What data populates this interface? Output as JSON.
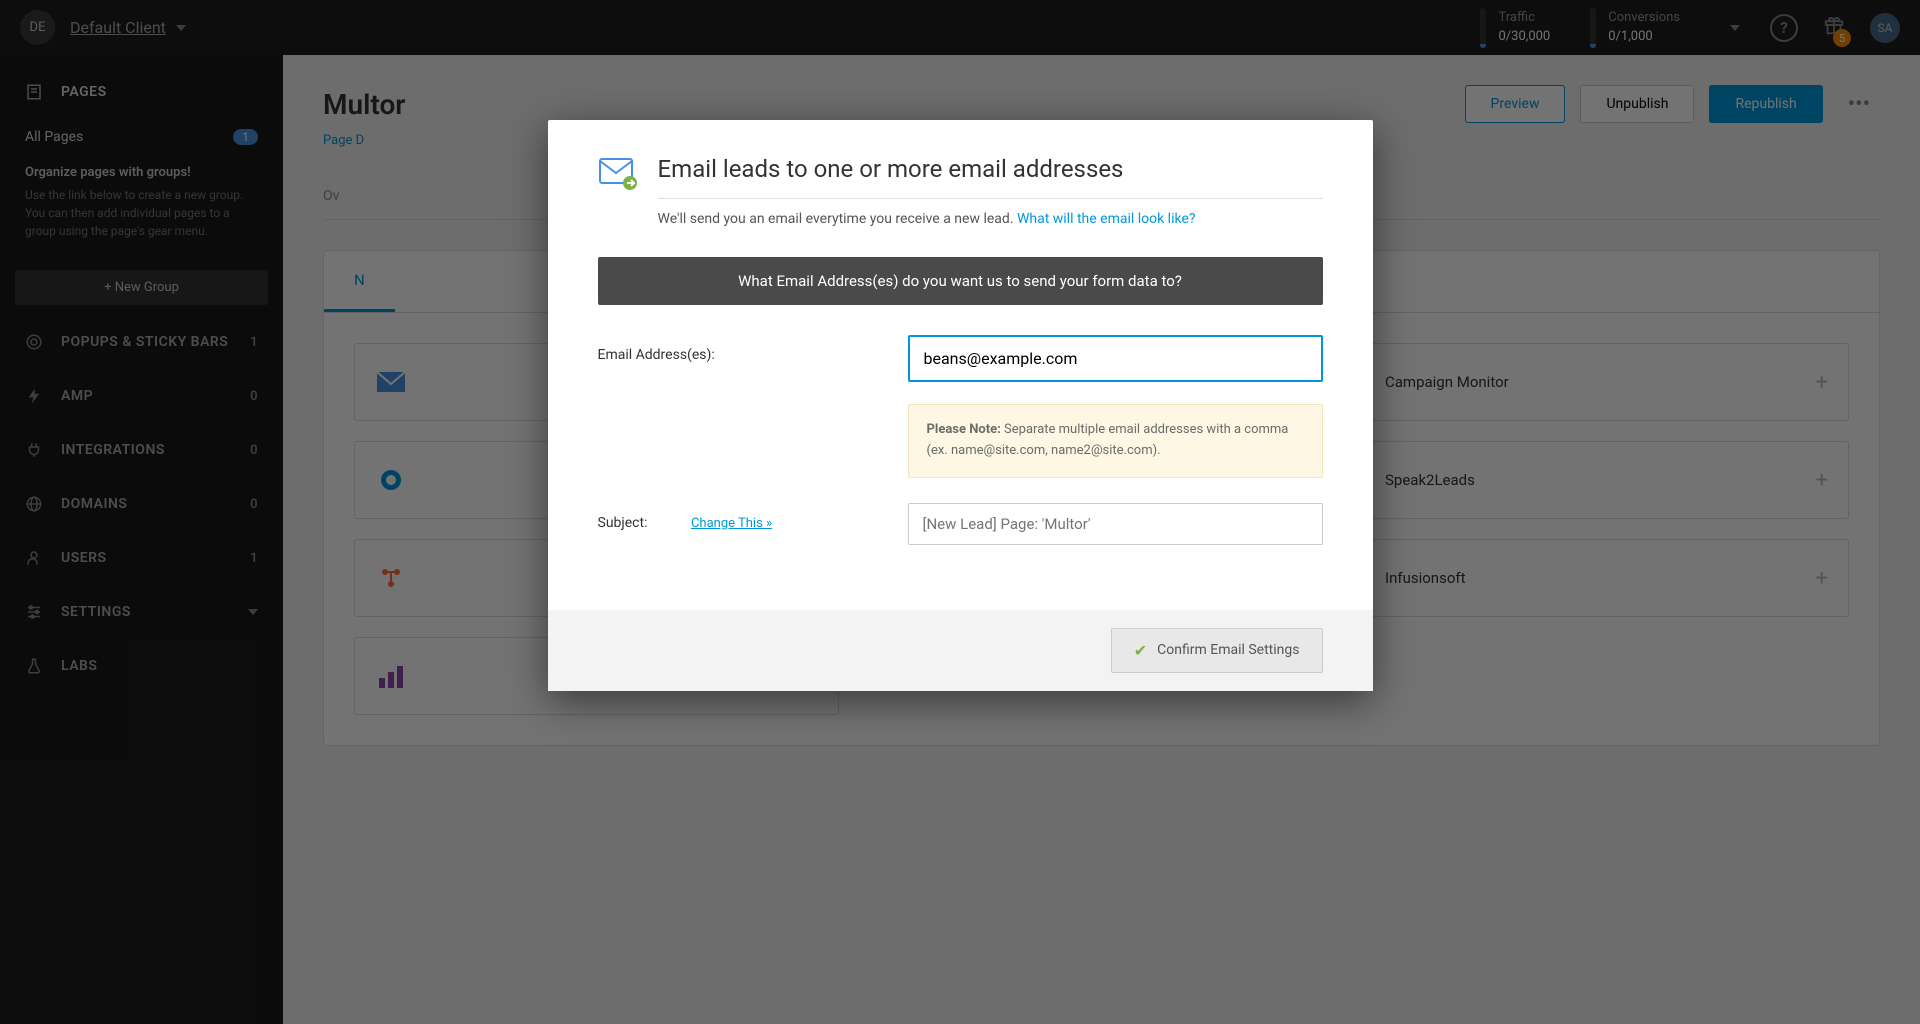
{
  "topbar": {
    "client_avatar": "DE",
    "client_name": "Default Client",
    "traffic_label": "Traffic",
    "traffic_value": "0/30,000",
    "conversions_label": "Conversions",
    "conversions_value": "0/1,000",
    "gift_badge": "5",
    "user_avatar": "SA"
  },
  "sidebar": {
    "pages_label": "PAGES",
    "all_pages_label": "All Pages",
    "all_pages_count": "1",
    "groups_title": "Organize pages with groups!",
    "groups_text": "Use the link below to create a new group. You can then add individual pages to a group using the page's gear menu.",
    "new_group_btn": "+ New Group",
    "popups_label": "POPUPS & STICKY BARS",
    "popups_count": "1",
    "amp_label": "AMP",
    "amp_count": "0",
    "integrations_label": "INTEGRATIONS",
    "integrations_count": "0",
    "domains_label": "DOMAINS",
    "domains_count": "0",
    "users_label": "USERS",
    "users_count": "1",
    "settings_label": "SETTINGS",
    "labs_label": "LABS"
  },
  "main": {
    "title": "Multor",
    "preview_btn": "Preview",
    "unpublish_btn": "Unpublish",
    "republish_btn": "Republish",
    "breadcrumb": "Page D",
    "overview_tab": "Ov"
  },
  "int_tabs": {
    "active": "N"
  },
  "integrations": {
    "campaign_monitor": "Campaign Monitor",
    "speak2leads": "Speak2Leads",
    "infusionsoft": "Infusionsoft"
  },
  "modal": {
    "title": "Email leads to one or more email addresses",
    "subtitle_prefix": "We'll send you an email everytime you receive a new lead. ",
    "subtitle_link": "What will the email look like?",
    "question": "What Email Address(es) do you want us to send your form data to?",
    "email_label": "Email Address(es):",
    "email_value": "beans@example.com",
    "note_bold": "Please Note:",
    "note_text": " Separate multiple email addresses with a comma (ex. name@site.com, name2@site.com).",
    "subject_label": "Subject:",
    "change_link": "Change This »",
    "subject_placeholder": "[New Lead] Page: 'Multor'",
    "confirm_btn": "Confirm Email Settings"
  }
}
